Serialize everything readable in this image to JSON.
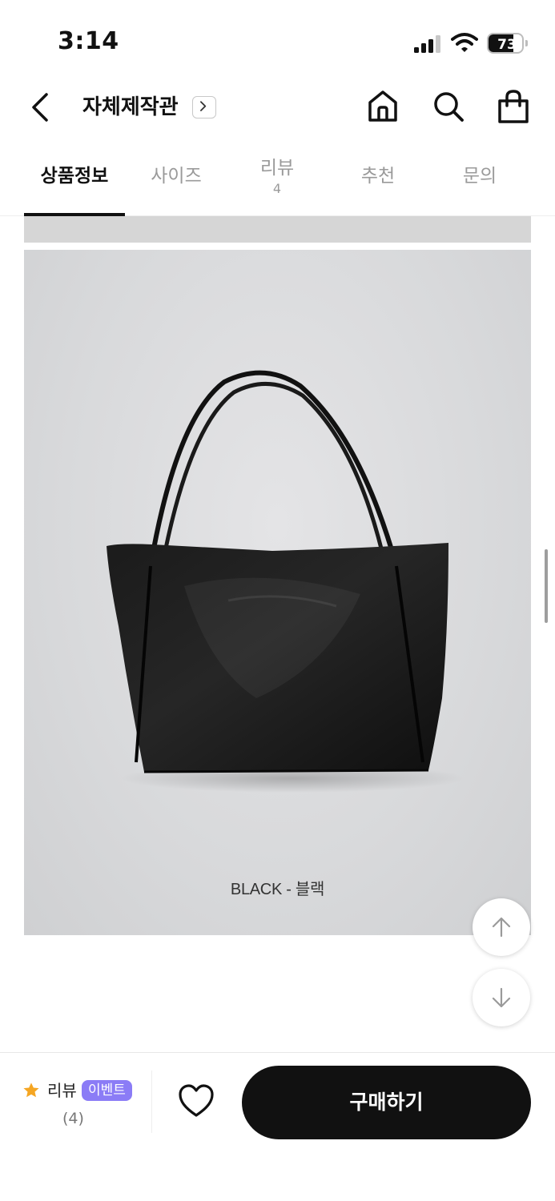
{
  "status_bar": {
    "time": "3:14",
    "battery_level": "73",
    "battery_fraction": 0.73,
    "icons": [
      "cellular-signal-icon",
      "wifi-icon",
      "battery-icon"
    ]
  },
  "header": {
    "title": "자체제작관",
    "icons": [
      "back-chevron-icon",
      "chevron-right-icon",
      "home-icon",
      "search-icon",
      "shopping-bag-icon"
    ]
  },
  "tabs": [
    {
      "label": "상품정보",
      "active": true
    },
    {
      "label": "사이즈",
      "active": false
    },
    {
      "label": "리뷰",
      "count": "4",
      "active": false
    },
    {
      "label": "추천",
      "active": false
    },
    {
      "label": "문의",
      "active": false
    }
  ],
  "content": {
    "image_caption": "BLACK - 블랙",
    "image_subject": "black-leather-tote-bag",
    "floating_buttons": [
      "arrow-up-icon",
      "arrow-down-icon"
    ]
  },
  "bottom_bar": {
    "review_label": "리뷰",
    "event_badge": "이벤트",
    "review_count": "(4)",
    "buy_label": "구매하기",
    "icons": [
      "star-icon",
      "heart-outline-icon"
    ]
  },
  "colors": {
    "primary": "#111111",
    "badge": "#8b7cf6",
    "star": "#f5a623",
    "tab_inactive": "#9a9a9a",
    "image_bg": "#d8d9db"
  }
}
